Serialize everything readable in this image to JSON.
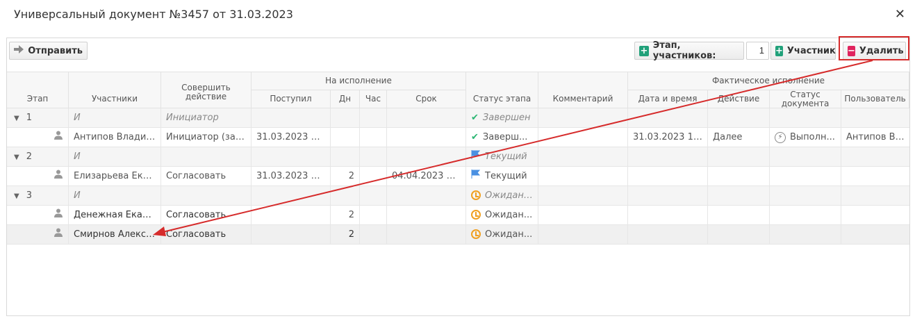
{
  "window": {
    "title": "Универсальный документ №3457 от 31.03.2023",
    "close_glyph": "✕"
  },
  "toolbar": {
    "send_label": "Отправить",
    "stage_label": "Этап, участников:",
    "stage_count": "1",
    "participant_label": "Участник",
    "delete_label": "Удалить"
  },
  "headers": {
    "stage": "Этап",
    "participants": "Участники",
    "action": "Совершить действие",
    "in_progress": "На исполнение",
    "received": "Поступил",
    "days": "Дн",
    "hours": "Час",
    "deadline": "Срок",
    "stage_status": "Статус этапа",
    "comment": "Комментарий",
    "actual": "Фактическое исполнение",
    "datetime": "Дата и время",
    "act": "Действие",
    "doc_status": "Статус документа",
    "user": "Пользователь"
  },
  "rows": [
    {
      "type": "group",
      "stage": "1",
      "participant": "И",
      "action": "Инициатор",
      "status": "Завершен",
      "status_icon": "check"
    },
    {
      "type": "item",
      "participant": "Антипов Владим...",
      "action": "Инициатор (зап...",
      "received": "31.03.2023 17:...",
      "status": "Заверш...",
      "status_icon": "check",
      "datetime": "31.03.2023 18:...",
      "act": "Далее",
      "doc_status": "Выполн...",
      "user": "Антипов В.А."
    },
    {
      "type": "group",
      "stage": "2",
      "participant": "И",
      "status": "Текущий",
      "status_icon": "flag"
    },
    {
      "type": "item",
      "participant": "Елизарьева Екат...",
      "action": "Согласовать",
      "received": "31.03.2023 18:...",
      "days": "2",
      "deadline": "04.04.2023 17:...",
      "status": "Текущий",
      "status_icon": "flag"
    },
    {
      "type": "group",
      "stage": "3",
      "participant": "И",
      "status": "Ожидание",
      "status_icon": "clock"
    },
    {
      "type": "item",
      "participant": "Денежная Екате...",
      "action": "Согласовать",
      "days": "2",
      "status": "Ожидан...",
      "status_icon": "clock"
    },
    {
      "type": "item",
      "participant": "Смирнов Алекса...",
      "action": "Согласовать",
      "days": "2",
      "status": "Ожидан...",
      "status_icon": "clock",
      "selected": true
    }
  ],
  "colors": {
    "accent_green": "#21a17a",
    "accent_red": "#e0245e",
    "annotation_red": "#d62b2b"
  }
}
